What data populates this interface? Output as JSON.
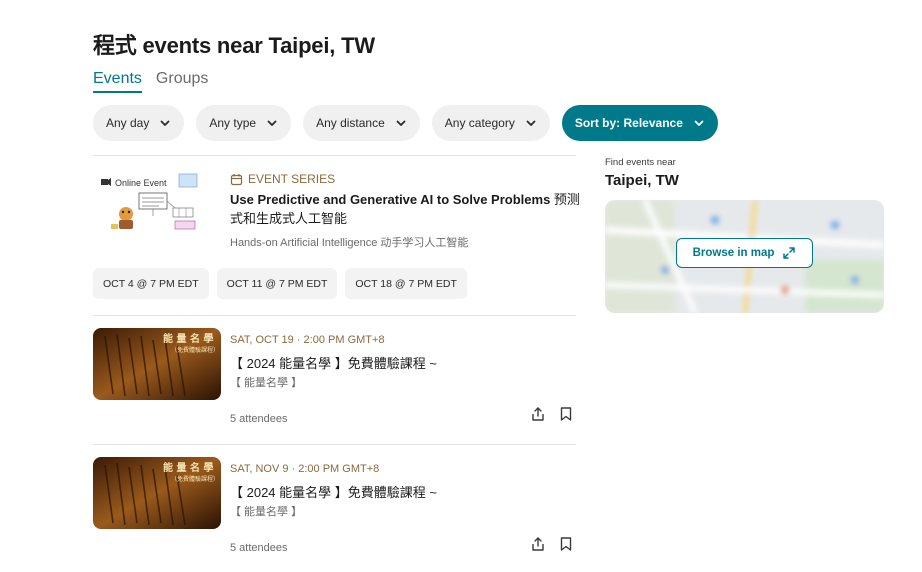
{
  "page": {
    "title": "程式 events near Taipei, TW"
  },
  "tabs": [
    {
      "label": "Events",
      "active": true
    },
    {
      "label": "Groups",
      "active": false
    }
  ],
  "filters": [
    {
      "label": "Any day",
      "icon": "chevron-down-icon"
    },
    {
      "label": "Any type",
      "icon": "chevron-down-icon"
    },
    {
      "label": "Any distance",
      "icon": "chevron-down-icon"
    },
    {
      "label": "Any category",
      "icon": "chevron-down-icon"
    }
  ],
  "sort": {
    "label": "Sort by: Relevance",
    "icon": "chevron-down-icon"
  },
  "series_event": {
    "thumb_label": "Online Event",
    "series_label": "EVENT SERIES",
    "title_en": "Use Predictive and Generative AI to Solve Problems ",
    "title_cjk": "预测式和生成式人工智能",
    "group": "Hands-on Artificial Intelligence 动手学习人工智能",
    "dates": [
      "OCT 4 @ 7 PM EDT",
      "OCT 11 @ 7 PM EDT",
      "OCT 18 @ 7 PM EDT"
    ]
  },
  "events": [
    {
      "date": "SAT, OCT 19 · 2:00 PM GMT+8",
      "title": "【 2024 能量名學 】免費體驗課程 ~",
      "group": "【 能量名學 】",
      "attendees": "5 attendees",
      "thumb_text": "能 量 名 學",
      "thumb_sub": "（免費體驗課程）"
    },
    {
      "date": "SAT, NOV 9 · 2:00 PM GMT+8",
      "title": "【 2024 能量名學 】免費體驗課程 ~",
      "group": "【 能量名學 】",
      "attendees": "5 attendees",
      "thumb_text": "能 量 名 學",
      "thumb_sub": "（免費體驗課程）"
    }
  ],
  "sidebar": {
    "find_label": "Find events near",
    "city": "Taipei, TW",
    "map_button": "Browse in map",
    "map_icon": "expand-icon"
  },
  "colors": {
    "accent": "#00798a",
    "series_meta": "#8a6a3e"
  }
}
